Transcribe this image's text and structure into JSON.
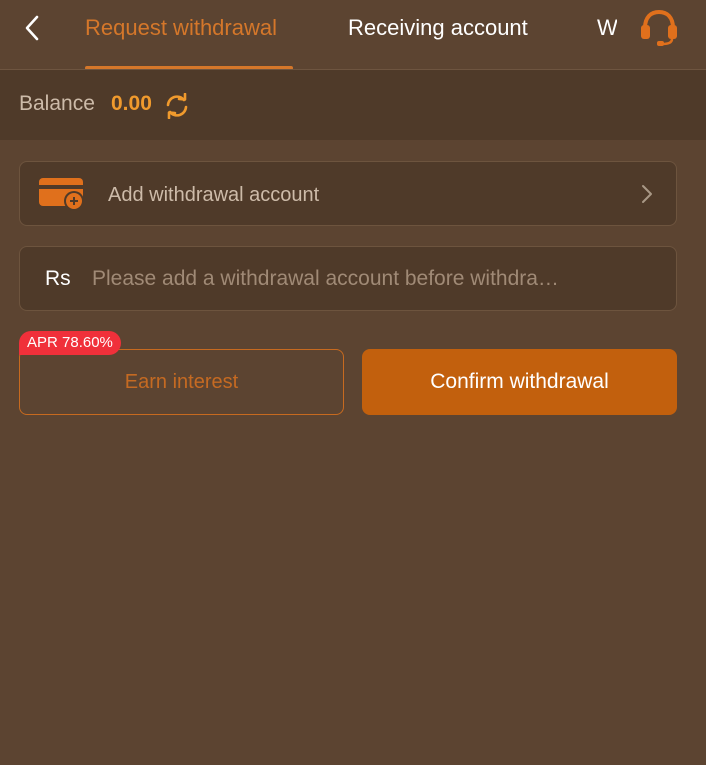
{
  "nav": {
    "tabs": [
      {
        "label": "Request withdrawal",
        "active": true
      },
      {
        "label": "Receiving account",
        "active": false
      },
      {
        "label": "W",
        "active": false
      }
    ]
  },
  "icons": {
    "back": "chevron-left-icon",
    "support": "headset-icon",
    "refresh": "refresh-icon",
    "wallet": "wallet-add-icon",
    "chevron": "chevron-right-icon"
  },
  "balance": {
    "label": "Balance",
    "value": "0.00"
  },
  "account": {
    "label": "Add withdrawal account"
  },
  "amount": {
    "currency": "Rs",
    "placeholder": "Please add a withdrawal account before withdra…"
  },
  "actions": {
    "apr_badge": "APR 78.60%",
    "earn_label": "Earn interest",
    "confirm_label": "Confirm withdrawal"
  },
  "colors": {
    "background": "#5c4431",
    "panel": "#4f3a29",
    "accent": "#d5772a",
    "primary_button": "#c2600d",
    "badge": "#f0303a"
  }
}
